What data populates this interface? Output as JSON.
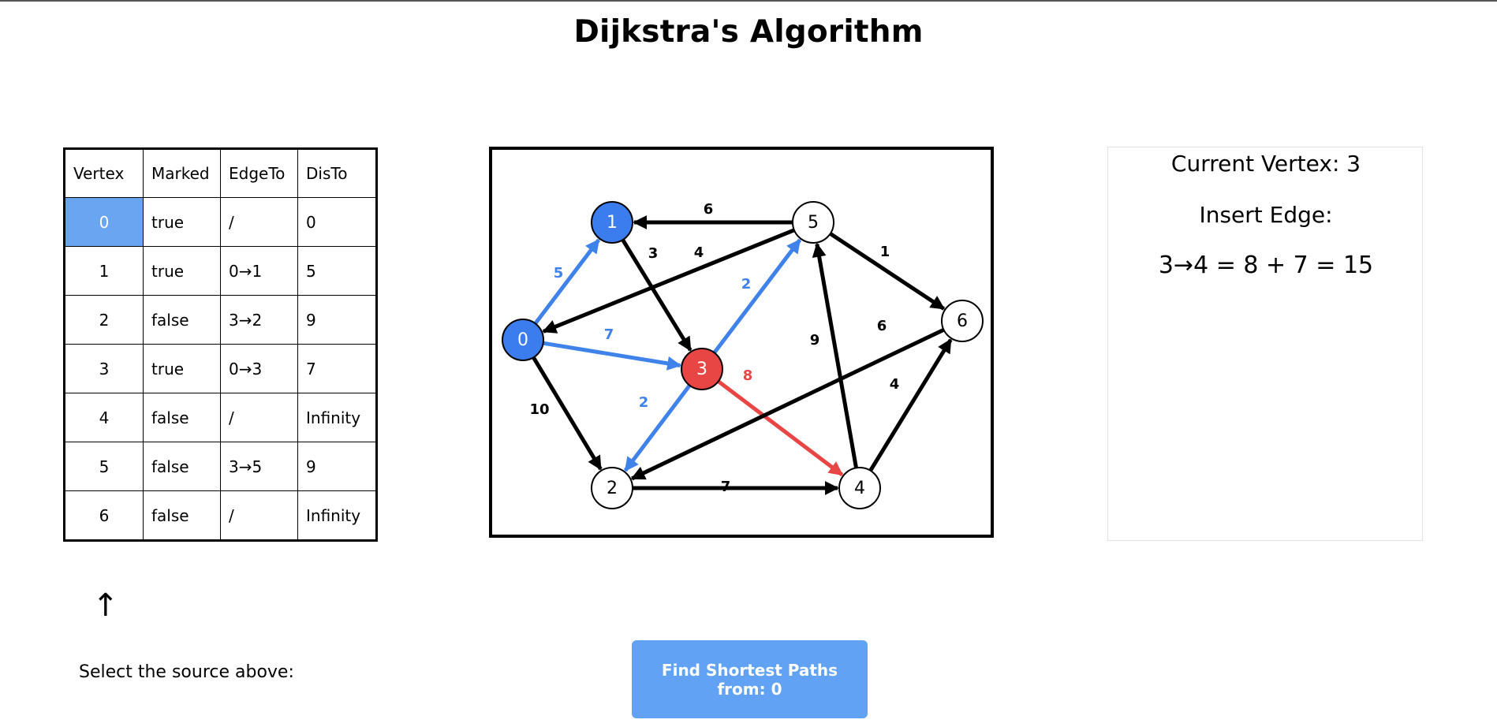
{
  "page": {
    "title": "Dijkstra's Algorithm"
  },
  "table": {
    "headers": [
      "Vertex",
      "Marked",
      "EdgeTo",
      "DisTo"
    ],
    "rows": [
      {
        "vertex": "0",
        "marked": "true",
        "edgeTo": "/",
        "disTo": "0"
      },
      {
        "vertex": "1",
        "marked": "true",
        "edgeTo": "0→1",
        "disTo": "5"
      },
      {
        "vertex": "2",
        "marked": "false",
        "edgeTo": "3→2",
        "disTo": "9"
      },
      {
        "vertex": "3",
        "marked": "true",
        "edgeTo": "0→3",
        "disTo": "7"
      },
      {
        "vertex": "4",
        "marked": "false",
        "edgeTo": "/",
        "disTo": "Infinity"
      },
      {
        "vertex": "5",
        "marked": "false",
        "edgeTo": "3→5",
        "disTo": "9"
      },
      {
        "vertex": "6",
        "marked": "false",
        "edgeTo": "/",
        "disTo": "Infinity"
      }
    ],
    "selected_vertex": "0"
  },
  "graph": {
    "nodes": [
      {
        "id": "0",
        "state": "visited"
      },
      {
        "id": "1",
        "state": "visited"
      },
      {
        "id": "2",
        "state": "unvisited"
      },
      {
        "id": "3",
        "state": "current"
      },
      {
        "id": "4",
        "state": "unvisited"
      },
      {
        "id": "5",
        "state": "unvisited"
      },
      {
        "id": "6",
        "state": "unvisited"
      }
    ],
    "edges": [
      {
        "from": "0",
        "to": "1",
        "weight": "5",
        "state": "tree"
      },
      {
        "from": "0",
        "to": "3",
        "weight": "7",
        "state": "tree"
      },
      {
        "from": "0",
        "to": "2",
        "weight": "10",
        "state": "normal"
      },
      {
        "from": "1",
        "to": "3",
        "weight": "3",
        "state": "normal"
      },
      {
        "from": "5",
        "to": "1",
        "weight": "6",
        "state": "normal"
      },
      {
        "from": "5",
        "to": "0",
        "weight": "4",
        "state": "normal"
      },
      {
        "from": "3",
        "to": "5",
        "weight": "2",
        "state": "tree"
      },
      {
        "from": "3",
        "to": "2",
        "weight": "2",
        "state": "tree"
      },
      {
        "from": "3",
        "to": "4",
        "weight": "8",
        "state": "active"
      },
      {
        "from": "5",
        "to": "6",
        "weight": "1",
        "state": "normal"
      },
      {
        "from": "4",
        "to": "5",
        "weight": "9",
        "state": "normal"
      },
      {
        "from": "6",
        "to": "2",
        "weight": "6",
        "state": "normal"
      },
      {
        "from": "4",
        "to": "6",
        "weight": "4",
        "state": "normal"
      },
      {
        "from": "2",
        "to": "4",
        "weight": "7",
        "state": "normal"
      }
    ]
  },
  "colors": {
    "visited": "#3b7ded",
    "current": "#e84545",
    "tree_edge": "#3f82ea",
    "active_edge": "#e84545",
    "selected_cell": "#6aa5f1",
    "button": "#62a2f4"
  },
  "info": {
    "current_vertex": "Current Vertex: 3",
    "insert_edge_label": "Insert Edge:",
    "equation": "3→4 = 8 + 7 = 15"
  },
  "selector": {
    "arrow": "↑",
    "label": "Select the source above:"
  },
  "button": {
    "label": "Find Shortest Paths from: 0"
  }
}
